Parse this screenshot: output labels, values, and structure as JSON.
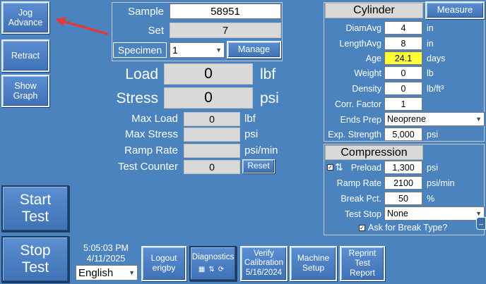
{
  "left": {
    "jog_advance": "Jog Advance",
    "retract": "Retract",
    "show_graph": "Show Graph",
    "start_test": "Start Test",
    "stop_test": "Stop Test"
  },
  "clock": {
    "time": "5:05:03 PM",
    "date": "4/11/2025",
    "language": "English"
  },
  "sample": {
    "sample_label": "Sample",
    "sample_value": "58951",
    "set_label": "Set",
    "set_value": "7",
    "specimen_label": "Specimen",
    "specimen_value": "1",
    "manage_label": "Manage"
  },
  "readouts": {
    "load_label": "Load",
    "load_value": "0",
    "load_unit": "lbf",
    "stress_label": "Stress",
    "stress_value": "0",
    "stress_unit": "psi",
    "max_load_label": "Max Load",
    "max_load_value": "0",
    "max_load_unit": "lbf",
    "max_stress_label": "Max Stress",
    "max_stress_value": "",
    "max_stress_unit": "psi",
    "ramp_rate_label": "Ramp Rate",
    "ramp_rate_value": "",
    "ramp_rate_unit": "psi/min",
    "test_counter_label": "Test Counter",
    "test_counter_value": "0",
    "reset_label": "Reset"
  },
  "cylinder": {
    "title": "Cylinder",
    "measure_label": "Measure",
    "diam_label": "DiamAvg",
    "diam_value": "4",
    "diam_unit": "in",
    "length_label": "LengthAvg",
    "length_value": "8",
    "length_unit": "in",
    "age_label": "Age",
    "age_value": "24.1",
    "age_unit": "days",
    "weight_label": "Weight",
    "weight_value": "0",
    "weight_unit": "lb",
    "density_label": "Density",
    "density_value": "0",
    "density_unit": "lb/ft³",
    "corr_label": "Corr. Factor",
    "corr_value": "1",
    "ends_label": "Ends Prep",
    "ends_value": "Neoprene",
    "exp_label": "Exp. Strength",
    "exp_value": "5,000",
    "exp_unit": "psi"
  },
  "compression": {
    "title": "Compression",
    "preload_label": "Preload",
    "preload_value": "1,300",
    "preload_unit": "psi",
    "ramp_label": "Ramp Rate",
    "ramp_value": "2100",
    "ramp_unit": "psi/min",
    "break_label": "Break Pct.",
    "break_value": "50",
    "break_unit": "%",
    "stop_label": "Test Stop",
    "stop_value": "None",
    "ask_label": "Ask for Break Type?"
  },
  "bottom": {
    "logout": "Logout",
    "user": "erigby",
    "diagnostics": "Diagnostics",
    "verify": "Verify",
    "calibration": "Calibration",
    "cal_date": "5/16/2024",
    "machine": "Machine",
    "setup": "Setup",
    "reprint": "Reprint",
    "test": "Test",
    "report": "Report"
  },
  "colors": {
    "background": "#4a83bd",
    "annotation_arrow": "#e23b3b",
    "age_highlight": "#ffff33"
  }
}
